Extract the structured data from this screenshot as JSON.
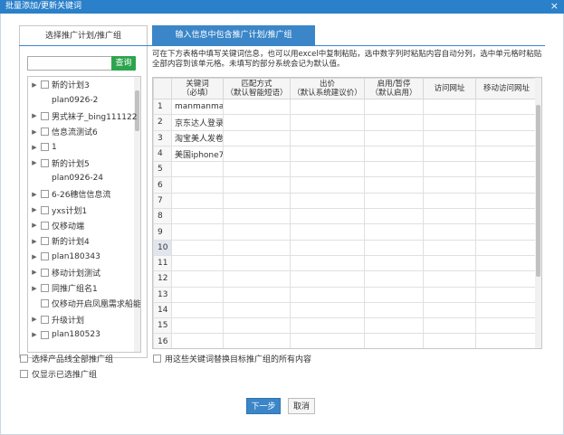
{
  "window": {
    "title": "批量添加/更新关键词",
    "close": "×"
  },
  "tabs": [
    {
      "label": "选择推广计划/推广组",
      "active": false
    },
    {
      "label": "输入信息中包含推广计划/推广组",
      "active": true
    }
  ],
  "search": {
    "placeholder": "",
    "button": "查询"
  },
  "tree": [
    {
      "label": "新的计划3",
      "arrow": true,
      "checkbox": true
    },
    {
      "label": "plan0926-2",
      "arrow": false,
      "checkbox": false
    },
    {
      "label": "男式袜子_bing111122",
      "arrow": true,
      "checkbox": true
    },
    {
      "label": "信息流测试6",
      "arrow": true,
      "checkbox": true
    },
    {
      "label": "1",
      "arrow": true,
      "checkbox": true
    },
    {
      "label": "新的计划5",
      "arrow": true,
      "checkbox": true
    },
    {
      "label": "plan0926-24",
      "arrow": false,
      "checkbox": false
    },
    {
      "label": "6-26穗信信息流",
      "arrow": true,
      "checkbox": true
    },
    {
      "label": "yxs计划1",
      "arrow": true,
      "checkbox": true
    },
    {
      "label": "仅移动端",
      "arrow": true,
      "checkbox": true
    },
    {
      "label": "新的计划4",
      "arrow": true,
      "checkbox": true
    },
    {
      "label": "plan180343",
      "arrow": true,
      "checkbox": true
    },
    {
      "label": "移动计划测试",
      "arrow": true,
      "checkbox": true
    },
    {
      "label": "同推广组名1",
      "arrow": true,
      "checkbox": true
    },
    {
      "label": "仅移动开启凤凰需求船能",
      "arrow": false,
      "checkbox": true
    },
    {
      "label": "升级计划",
      "arrow": true,
      "checkbox": true
    },
    {
      "label": "plan180523",
      "arrow": true,
      "checkbox": true
    }
  ],
  "description": "可在下方表格中填写关键词信息，也可以用excel中复制粘贴，选中数字列时粘贴内容自动分列，选中单元格时粘贴全部内容到该单元格。未填写的部分系统会记为默认值。",
  "grid": {
    "headers": [
      {
        "line1": "",
        "line2": ""
      },
      {
        "line1": "关键词",
        "line2": "（必填）"
      },
      {
        "line1": "匹配方式",
        "line2": "（默认智能短语）"
      },
      {
        "line1": "出价",
        "line2": "（默认系统建议价）"
      },
      {
        "line1": "启用/暂停",
        "line2": "（默认启用）"
      },
      {
        "line1": "访问网址",
        "line2": ""
      },
      {
        "line1": "移动访问网址",
        "line2": ""
      }
    ],
    "rows": [
      {
        "num": "1",
        "keyword": "manmanmai"
      },
      {
        "num": "2",
        "keyword": "京东达人登录"
      },
      {
        "num": "3",
        "keyword": "淘宝美人发卷"
      },
      {
        "num": "4",
        "keyword": "美国iphone7p"
      },
      {
        "num": "5",
        "keyword": ""
      },
      {
        "num": "6",
        "keyword": ""
      },
      {
        "num": "7",
        "keyword": ""
      },
      {
        "num": "8",
        "keyword": ""
      },
      {
        "num": "9",
        "keyword": ""
      },
      {
        "num": "10",
        "keyword": ""
      },
      {
        "num": "11",
        "keyword": ""
      },
      {
        "num": "12",
        "keyword": ""
      },
      {
        "num": "13",
        "keyword": ""
      },
      {
        "num": "14",
        "keyword": ""
      },
      {
        "num": "15",
        "keyword": ""
      },
      {
        "num": "16",
        "keyword": ""
      }
    ],
    "selected_row": "10"
  },
  "options": {
    "select_all_product": "选择产品线全部推广组",
    "only_selected": "仅显示已选推广组",
    "replace_all": "用这些关键词替换目标推广组的所有内容"
  },
  "buttons": {
    "next": "下一步",
    "cancel": "取消"
  },
  "colors": {
    "accent": "#3b86c8",
    "title_bar": "#2a80c9",
    "search_button": "#2ea44f"
  }
}
